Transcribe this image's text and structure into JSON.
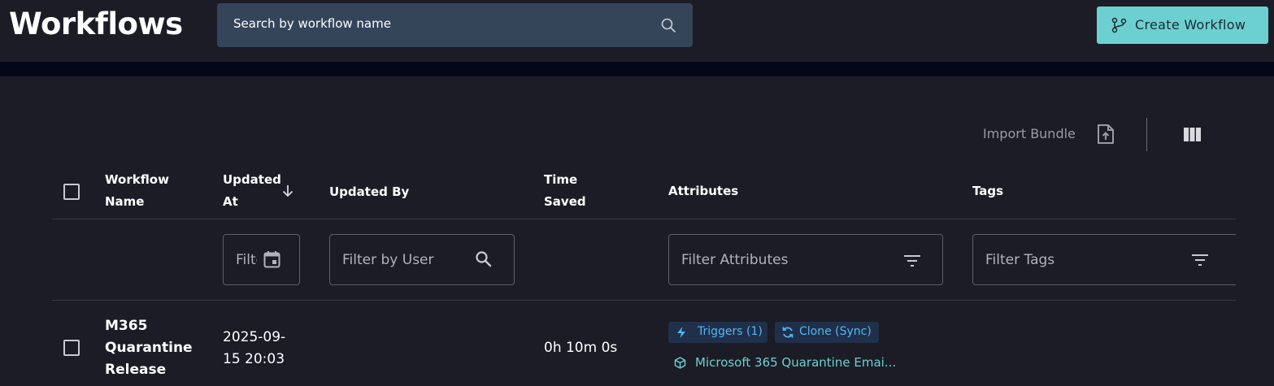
{
  "header": {
    "title": "Workflows",
    "search_placeholder": "Search by workflow name",
    "create_label": "Create Workflow"
  },
  "toolbar": {
    "import_label": "Import Bundle"
  },
  "table": {
    "columns": {
      "workflow_name_1": "Workflow",
      "workflow_name_2": "Name",
      "updated_at_1": "Updated",
      "updated_at_2": "At",
      "updated_by": "Updated By",
      "time_saved_1": "Time",
      "time_saved_2": "Saved",
      "attributes": "Attributes",
      "tags": "Tags"
    },
    "filters": {
      "date": "Filter",
      "user": "Filter by User",
      "attributes": "Filter Attributes",
      "tags": "Filter Tags"
    },
    "rows": [
      {
        "name_1": "M365",
        "name_2": "Quarantine",
        "name_3": "Release",
        "updated_at_1": "2025-09-",
        "updated_at_2": "15 20:03",
        "updated_by": "",
        "time_saved": "0h 10m 0s",
        "chips": [
          "Triggers (1)",
          "Clone (Sync)"
        ],
        "bundle": "Microsoft 365 Quarantine Emai..."
      }
    ]
  },
  "colors": {
    "background": "#1b1c26",
    "search_bg": "#34455a",
    "accent": "#6cd0d1",
    "chip_bg": "#20304a",
    "chip_text": "#52b6f2"
  }
}
